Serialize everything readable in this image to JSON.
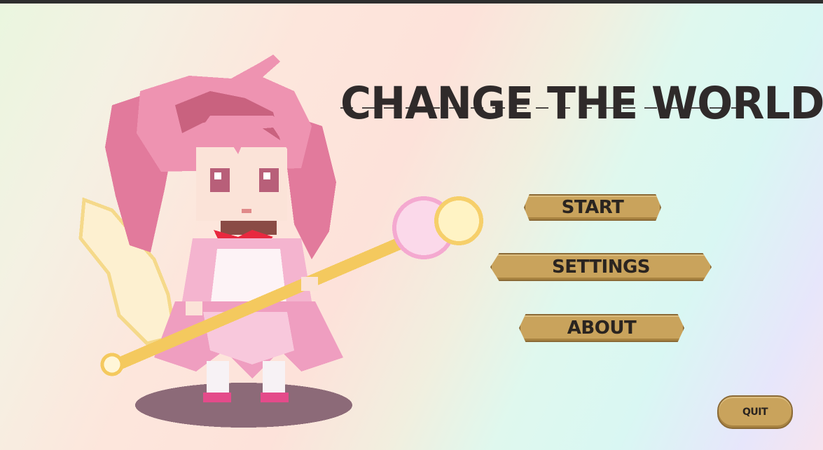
{
  "game": {
    "title": "CHANGE THE WORLD"
  },
  "menu": {
    "start_label": "START",
    "settings_label": "SETTINGS",
    "about_label": "ABOUT",
    "quit_label": "QUIT"
  },
  "colors": {
    "button_fill": "#c9a35c",
    "button_border": "#8b6a36",
    "title_text": "#2f2a2a",
    "hair_pink": "#e889a6",
    "dress_pink": "#f0a6c6",
    "staff_gold": "#f4c95e",
    "shadow": "#8c6a78"
  },
  "scene": {
    "character_icon": "magical-girl-sprite"
  }
}
